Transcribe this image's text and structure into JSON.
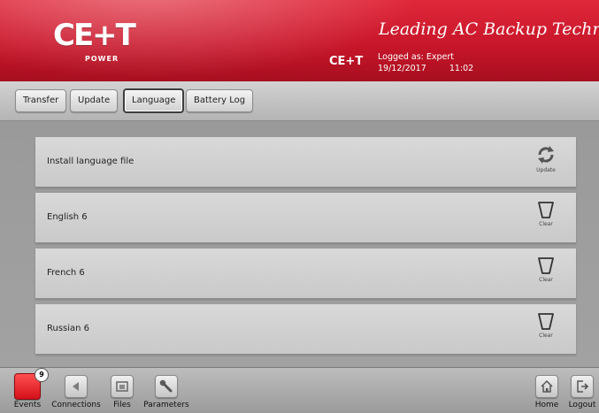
{
  "header": {
    "logo_text": "CE+T",
    "logo_sub": "POWER",
    "tagline": "Leading AC Backup Technology",
    "site_name": "CE+T",
    "logged_as": "Logged as: Expert",
    "date": "19/12/2017",
    "time": "11:02",
    "brand_color": "#c8162a"
  },
  "tabs": [
    {
      "label": "Transfer",
      "active": false
    },
    {
      "label": "Update",
      "active": false
    },
    {
      "label": "Language",
      "active": true
    },
    {
      "label": "Battery Log",
      "active": false
    }
  ],
  "rows": [
    {
      "label": "Install language file",
      "action_label": "Update",
      "action_icon": "refresh-icon"
    },
    {
      "label": "English 6",
      "action_label": "Clear",
      "action_icon": "trash-icon"
    },
    {
      "label": "French 6",
      "action_label": "Clear",
      "action_icon": "trash-icon"
    },
    {
      "label": "Russian 6",
      "action_label": "Clear",
      "action_icon": "trash-icon"
    }
  ],
  "bottom_nav": {
    "events": {
      "label": "Events",
      "count": "9",
      "icon": "events-icon"
    },
    "connections": {
      "label": "Connections",
      "icon": "connections-icon"
    },
    "files": {
      "label": "Files",
      "icon": "files-icon"
    },
    "parameters": {
      "label": "Parameters",
      "icon": "wrench-icon"
    },
    "home": {
      "label": "Home",
      "icon": "home-icon"
    },
    "logout": {
      "label": "Logout",
      "icon": "logout-icon"
    }
  }
}
